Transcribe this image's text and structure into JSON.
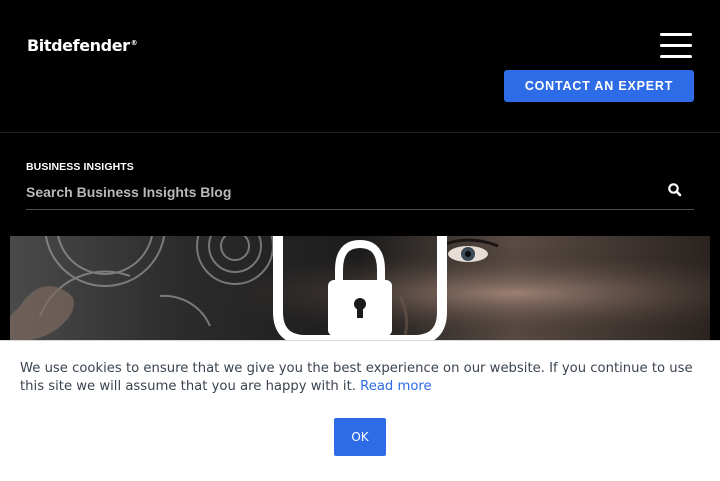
{
  "header": {
    "logo_text": "Bitdefender",
    "logo_mark": "®",
    "menu_icon": "hamburger-menu-icon",
    "contact_button_label": "CONTACT AN EXPERT"
  },
  "blog": {
    "section_label": "BUSINESS INSIGHTS",
    "search_placeholder": "Search Business Insights Blog",
    "search_value": "",
    "search_icon": "search-icon"
  },
  "hero": {
    "image_description_icon": "padlock-shield-icon"
  },
  "cookie": {
    "message": "We use cookies to ensure that we give you the best experience on our website. If you continue to use this site we will assume that you are happy with it.",
    "read_more_label": "Read more",
    "ok_label": "OK"
  },
  "colors": {
    "accent": "#2e6be6",
    "header_bg": "#000000",
    "banner_bg": "#ffffff",
    "banner_text": "#3a4450"
  }
}
